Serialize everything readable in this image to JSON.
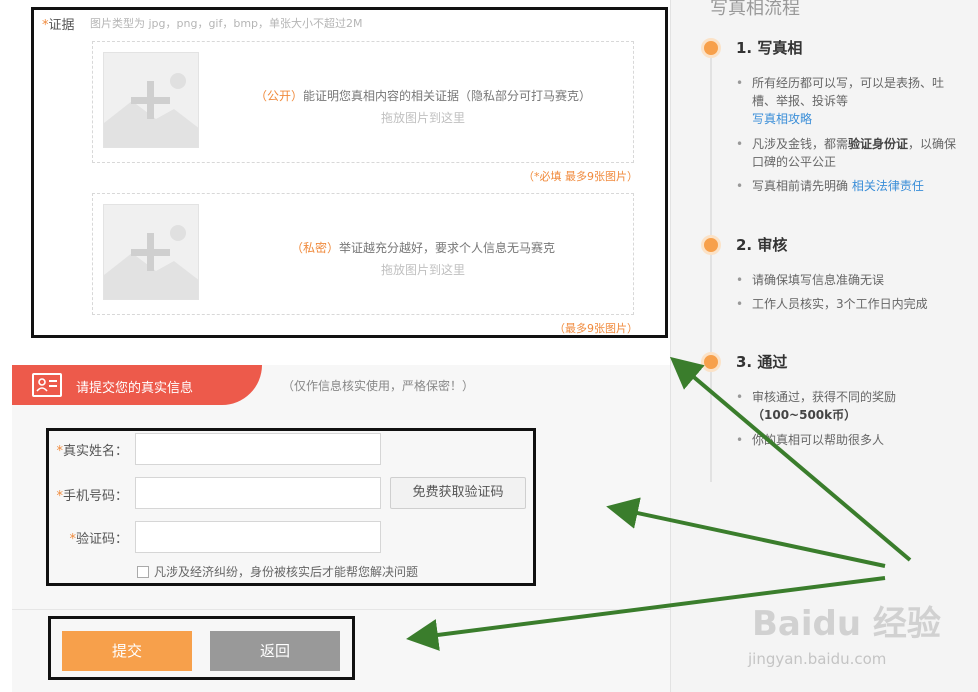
{
  "evidence": {
    "star": "*",
    "label": "证据",
    "hint": "图片类型为 jpg，png，gif，bmp，单张大小不超过2M",
    "public": {
      "tag": "（公开）",
      "text": "能证明您真相内容的相关证据（隐私部分可打马赛克）",
      "drop_hint": "拖放图片到这里",
      "note": "（*必填 最多9张图片）"
    },
    "private": {
      "tag": "（私密）",
      "text": "举证越充分越好，要求个人信息无马赛克",
      "drop_hint": "拖放图片到这里",
      "note": "（最多9张图片）"
    }
  },
  "identity": {
    "header": "请提交您的真实信息",
    "note": "（仅作信息核实使用，严格保密！）",
    "name_label": "真实姓名：",
    "phone_label": "手机号码：",
    "code_label": "验证码：",
    "get_code": "免费获取验证码",
    "check_text": "凡涉及经济纠纷，身份被核实后才能帮您解决问题"
  },
  "actions": {
    "submit": "提交",
    "back": "返回"
  },
  "sidebar": {
    "title": "写真相流程",
    "steps": [
      {
        "title": "1. 写真相",
        "b1": "所有经历都可以写，可以是表扬、吐槽、举报、投诉等",
        "b1_link": "写真相攻略",
        "b2_pre": "凡涉及金钱，都需",
        "b2_bold": "验证身份证",
        "b2_post": "，以确保口碑的公平公正",
        "b3_pre": "写真相前请先明确",
        "b3_link": "相关法律责任"
      },
      {
        "title": "2. 审核",
        "b1": "请确保填写信息准确无误",
        "b2": "工作人员核实，3个工作日内完成"
      },
      {
        "title": "3. 通过",
        "b1": "审核通过，获得不同的奖励",
        "b1_bold": "（100~500k币）",
        "b2": "你的真相可以帮助很多人"
      }
    ]
  },
  "watermark": {
    "brand": "Baidu 经验",
    "url": "jingyan.baidu.com"
  },
  "colors": {
    "accent": "#f7a04b",
    "header_red": "#ed5a4b",
    "arrow_green": "#3a7d2c",
    "link_blue": "#3a8ed8"
  }
}
